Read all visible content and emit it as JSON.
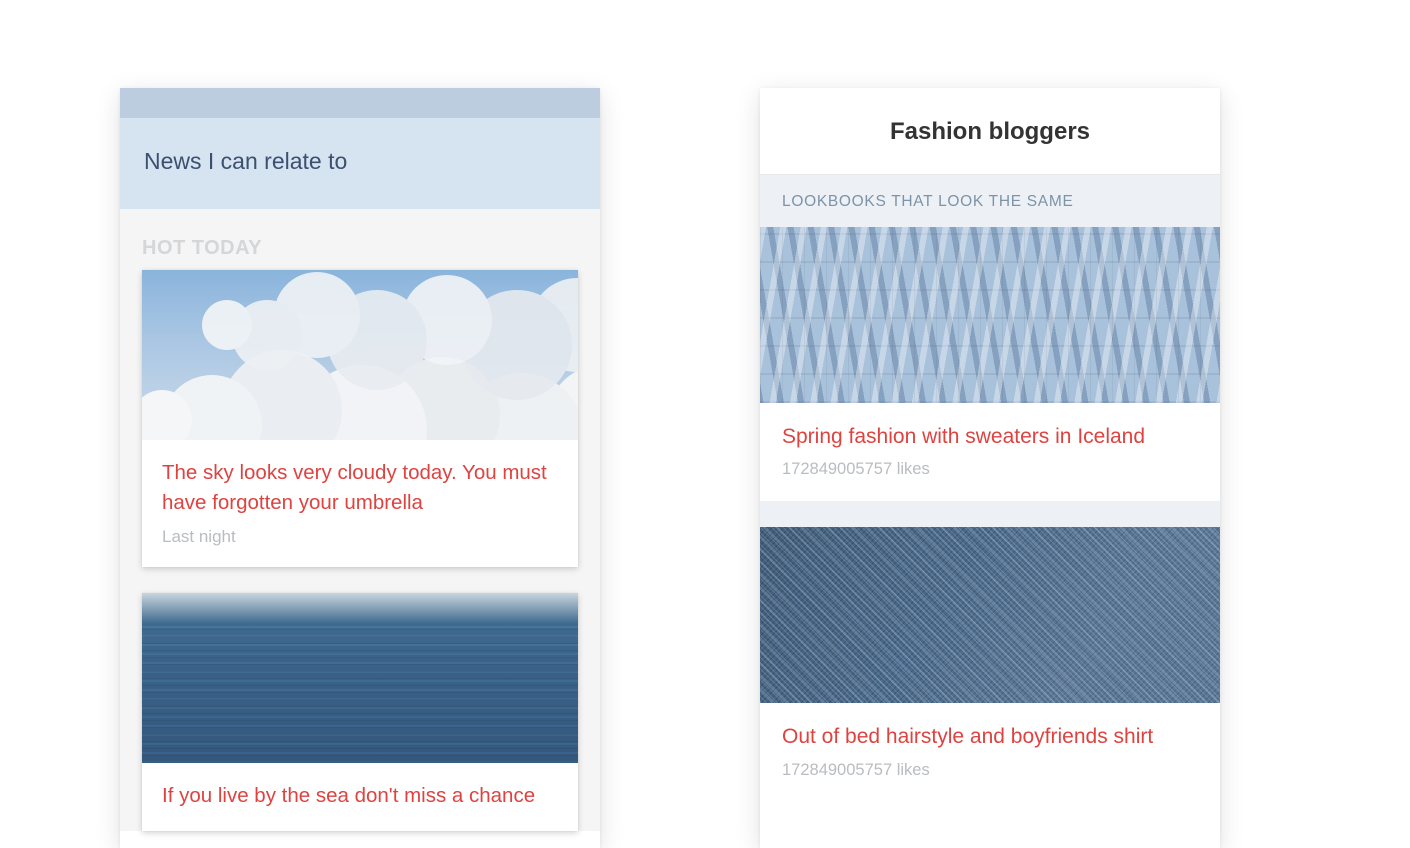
{
  "left": {
    "header_title": "News I can relate to",
    "list_header": "HOT TODAY",
    "items": [
      {
        "image": "clouds",
        "title": "The sky looks very cloudy today. You must have forgotten your umbrella",
        "subtitle": "Last night"
      },
      {
        "image": "ocean",
        "title": "If you live by the sea don't miss a chance",
        "subtitle": ""
      }
    ]
  },
  "right": {
    "header_title": "Fashion bloggers",
    "section_label": "LOOKBOOKS THAT LOOK THE SAME",
    "items": [
      {
        "image": "knit",
        "title": "Spring fashion with sweaters in Iceland",
        "subtitle": "172849005757 likes"
      },
      {
        "image": "denim",
        "title": "Out of bed hairstyle and boyfriends shirt",
        "subtitle": "172849005757 likes"
      }
    ]
  }
}
